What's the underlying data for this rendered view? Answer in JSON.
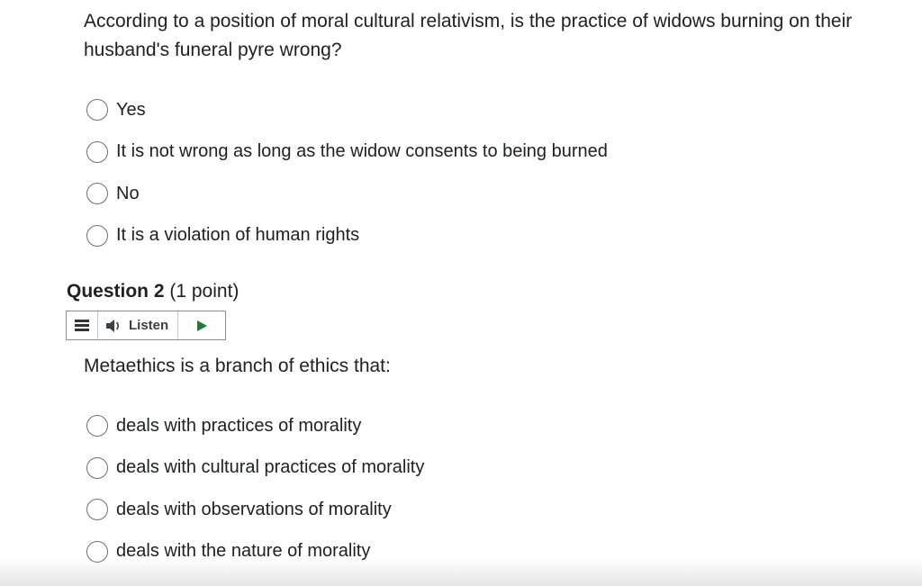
{
  "question1": {
    "text": "According to a position of moral cultural relativism, is the practice of widows burning on their husband's funeral pyre wrong?",
    "options": [
      {
        "label": "Yes"
      },
      {
        "label": "It is not wrong as long as the widow consents to being burned"
      },
      {
        "label": "No"
      },
      {
        "label": "It is a violation of human rights"
      }
    ]
  },
  "question2": {
    "heading_number": "Question 2",
    "heading_points": "(1 point)",
    "listen_label": "Listen",
    "text": "Metaethics is a branch of ethics that:",
    "options": [
      {
        "label": "deals with practices of morality"
      },
      {
        "label": "deals with cultural practices of morality"
      },
      {
        "label": "deals with observations of morality"
      },
      {
        "label": "deals with the nature of morality"
      }
    ]
  },
  "icons": {
    "menu": "menu-icon",
    "speaker": "speaker-icon",
    "play": "play-icon"
  },
  "colors": {
    "text": "#202122",
    "radio_border": "#6b6f73",
    "play_green": "#1f7a3a"
  }
}
